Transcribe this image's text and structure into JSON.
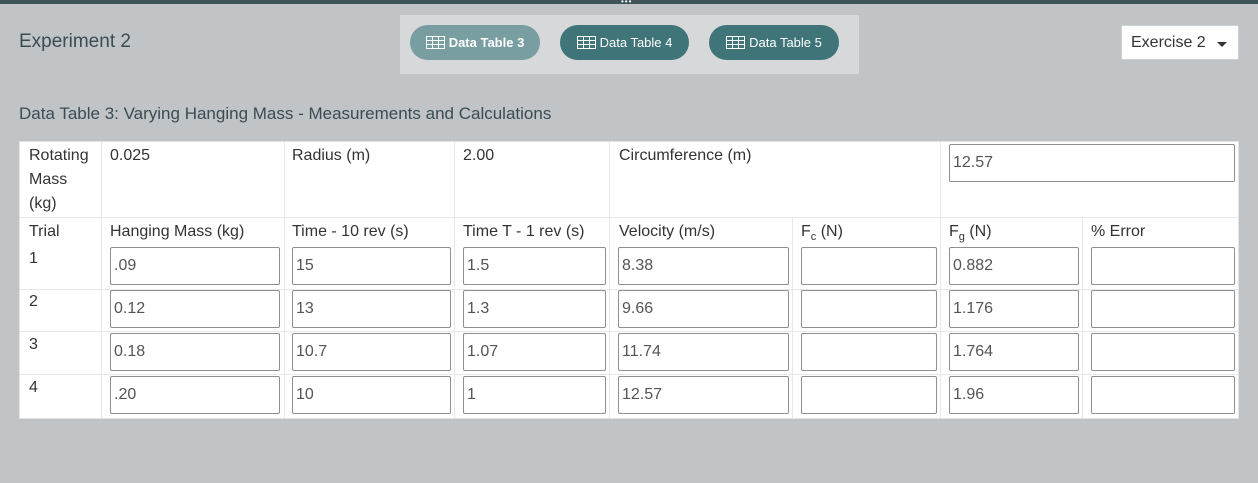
{
  "header": {
    "experiment_title": "Experiment 2",
    "tabs": [
      {
        "label": "Data Table 3",
        "active": true
      },
      {
        "label": "Data Table 4",
        "active": false
      },
      {
        "label": "Data Table 5",
        "active": false
      }
    ],
    "exercise_select": "Exercise 2"
  },
  "table": {
    "title": "Data Table 3: Varying Hanging Mass - Measurements and Calculations",
    "rotating_mass_label": "Rotating Mass (kg)",
    "rotating_mass_value": "0.025",
    "radius_label": "Radius (m)",
    "radius_value": "2.00",
    "circumference_label": "Circumference (m)",
    "circumference_value": "12.57",
    "columns": {
      "trial": "Trial",
      "hanging_mass": "Hanging Mass (kg)",
      "time_10": "Time - 10 rev (s)",
      "time_1": "Time T - 1 rev (s)",
      "velocity": "Velocity (m/s)",
      "fc_main": "F",
      "fc_sub": "c",
      "fc_unit": " (N)",
      "fg_main": "F",
      "fg_sub": "g",
      "fg_unit": " (N)",
      "error": "% Error"
    },
    "rows": [
      {
        "trial": "1",
        "hanging_mass": ".09",
        "time_10": "15",
        "time_1": "1.5",
        "velocity": "8.38",
        "fc": "",
        "fg": "0.882",
        "error": ""
      },
      {
        "trial": "2",
        "hanging_mass": "0.12",
        "time_10": "13",
        "time_1": "1.3",
        "velocity": "9.66",
        "fc": "",
        "fg": "1.176",
        "error": ""
      },
      {
        "trial": "3",
        "hanging_mass": "0.18",
        "time_10": "10.7",
        "time_1": "1.07",
        "velocity": "11.74",
        "fc": "",
        "fg": "1.764",
        "error": ""
      },
      {
        "trial": "4",
        "hanging_mass": ".20",
        "time_10": "10",
        "time_1": "1",
        "velocity": "12.57",
        "fc": "",
        "fg": "1.96",
        "error": ""
      }
    ]
  },
  "icons": {
    "tab_icon": "table-grid-icon",
    "select_icon": "caret-down-icon",
    "drag_icon": "drag-handle-icon"
  },
  "colors": {
    "background": "#c0c4c6",
    "tab": "#3f7478",
    "tab_active": "#789ea1",
    "topbar": "#3f5457"
  }
}
